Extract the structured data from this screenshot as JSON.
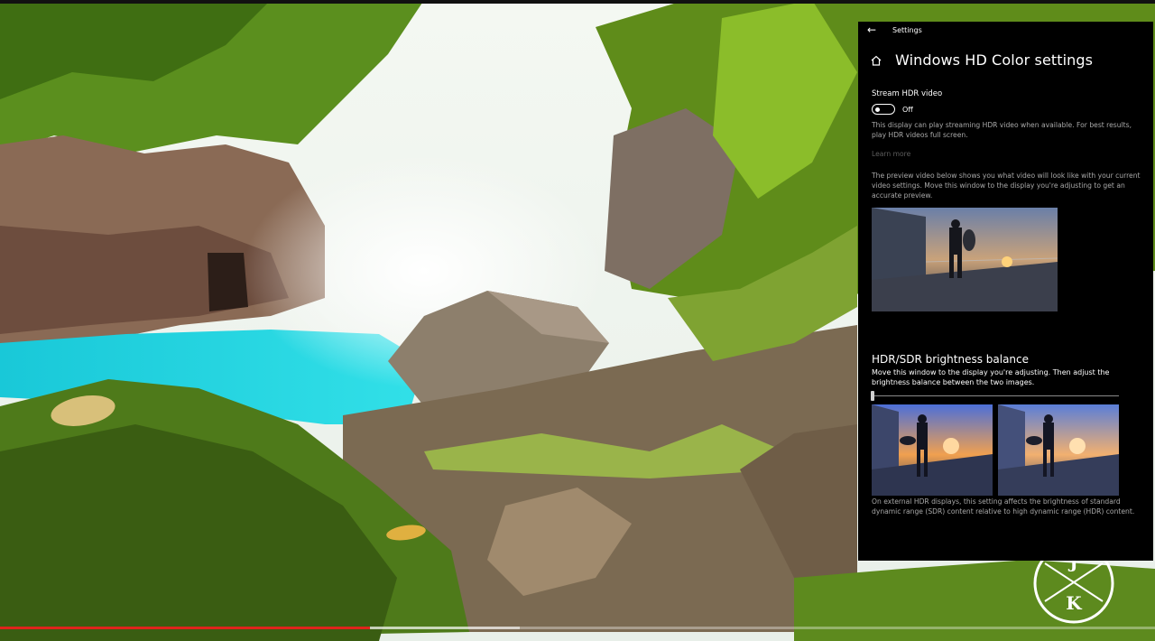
{
  "video": {
    "progress_percent": 32,
    "buffered_percent": 45
  },
  "logo": {
    "letters": [
      "J",
      "K"
    ]
  },
  "settings": {
    "window_title": "Settings",
    "page_title": "Windows HD Color settings",
    "stream_hdr": {
      "label": "Stream HDR video",
      "toggle_state": "Off",
      "toggle_on": false,
      "description": "This display can play streaming HDR video when available. For best results, play HDR videos full screen.",
      "learn_more": "Learn more"
    },
    "preview_description": "The preview video below shows you what video will look like with your current video settings. Move this window to the display you're adjusting to get an accurate preview.",
    "brightness": {
      "heading": "HDR/SDR brightness balance",
      "instructions": "Move this window to the display you're adjusting. Then adjust the brightness balance between the two images.",
      "slider_value_percent": 0,
      "footer": "On external HDR displays, this setting affects the brightness of standard dynamic range (SDR) content relative to high dynamic range (HDR) content."
    }
  },
  "colors": {
    "progress": "#e0241b",
    "window_bg": "#000000",
    "secondary_text": "#a8a8a8"
  },
  "icons": [
    "back-arrow-icon",
    "home-icon"
  ]
}
